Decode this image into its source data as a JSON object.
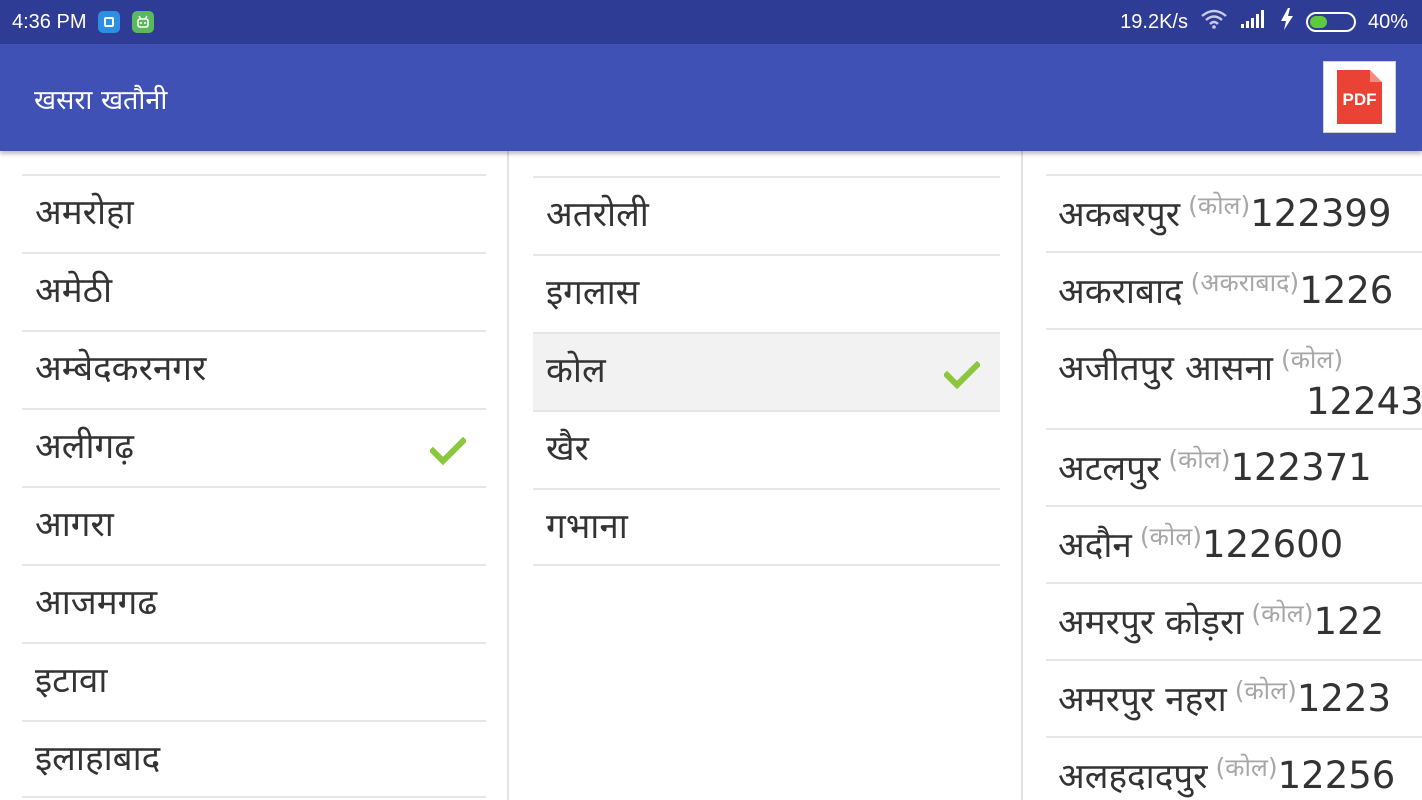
{
  "status_bar": {
    "time": "4:36 PM",
    "net_speed": "19.2K/s",
    "battery_percent": "40%",
    "battery_level": 0.4
  },
  "app_bar": {
    "title": "खसरा खतौनी",
    "pdf_label": "PDF"
  },
  "districts": {
    "items": [
      {
        "label": "अमरोहा",
        "selected": false
      },
      {
        "label": "अमेठी",
        "selected": false
      },
      {
        "label": "अम्बेदकरनगर",
        "selected": false
      },
      {
        "label": "अलीगढ़",
        "selected": true
      },
      {
        "label": "आगरा",
        "selected": false
      },
      {
        "label": "आजमगढ",
        "selected": false
      },
      {
        "label": "इटावा",
        "selected": false
      },
      {
        "label": "इलाहाबाद",
        "selected": false
      }
    ]
  },
  "tehsils": {
    "items": [
      {
        "label": "अतरोली",
        "selected": false
      },
      {
        "label": "इगलास",
        "selected": false
      },
      {
        "label": "कोल",
        "selected": true
      },
      {
        "label": "खैर",
        "selected": false
      },
      {
        "label": "गभाना",
        "selected": false
      }
    ]
  },
  "villages": {
    "items": [
      {
        "name": "अकबरपुर",
        "tehsil": "(कोल)",
        "code": "122399"
      },
      {
        "name": "अकराबाद",
        "tehsil": "(अकराबाद)",
        "code": "1226"
      },
      {
        "name": "अजीतपुर आसना",
        "tehsil": "(कोल)",
        "code": "12243"
      },
      {
        "name": "अटलपुर",
        "tehsil": "(कोल)",
        "code": "122371"
      },
      {
        "name": "अदौन",
        "tehsil": "(कोल)",
        "code": "122600"
      },
      {
        "name": "अमरपुर कोड़रा",
        "tehsil": "(कोल)",
        "code": "122"
      },
      {
        "name": "अमरपुर नहरा",
        "tehsil": "(कोल)",
        "code": "1223"
      },
      {
        "name": "अलहदादपुर",
        "tehsil": "(कोल)",
        "code": "12256"
      }
    ]
  },
  "colors": {
    "status_bar": "#2f3c95",
    "app_bar": "#3f51b5",
    "check": "#8cc63f",
    "pdf_red": "#ea4335"
  }
}
